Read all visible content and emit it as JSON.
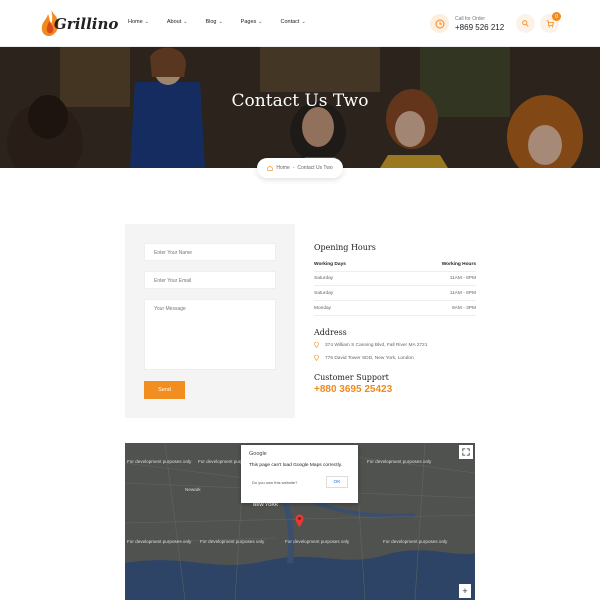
{
  "brand": {
    "name": "Grillino"
  },
  "nav": {
    "items": [
      {
        "label": "Home"
      },
      {
        "label": "About"
      },
      {
        "label": "Blog"
      },
      {
        "label": "Pages"
      },
      {
        "label": "Contact"
      }
    ]
  },
  "call": {
    "label": "Call for Order",
    "number": "+869 526 212"
  },
  "cart": {
    "count": "0"
  },
  "hero": {
    "title": "Contact Us Two"
  },
  "breadcrumb": {
    "home": "Home",
    "current": "Contact Us Two"
  },
  "form": {
    "name_placeholder": "Enter Your Name",
    "email_placeholder": "Enter Your Email",
    "message_placeholder": "Your Message",
    "send_label": "Send"
  },
  "hours": {
    "title": "Opening Hours",
    "header": {
      "left": "Working Days",
      "right": "Working Hours"
    },
    "rows": [
      {
        "day": "Saturday",
        "time": "11AM - 6PM"
      },
      {
        "day": "Saturday",
        "time": "11AM - 6PM"
      },
      {
        "day": "Monday",
        "time": "9AM - 3PM"
      }
    ]
  },
  "address": {
    "title": "Address",
    "lines": [
      "374 William S Canning Blvd, Fall River MA 2721",
      "776 David Tower SDD, New York, London"
    ]
  },
  "support": {
    "title": "Customer Support",
    "phone": "+880 3695 25423"
  },
  "map": {
    "dialog_title": "Google",
    "dialog_message": "This page can't load Google Maps correctly.",
    "dialog_question": "Do you own this website?",
    "dialog_ok": "OK",
    "watermark": "For development purposes only",
    "label_newark": "Newark",
    "label_ny": "NEW YORK",
    "zoom_in": "+"
  },
  "colors": {
    "accent": "#f28d1f",
    "dark": "#222222"
  }
}
